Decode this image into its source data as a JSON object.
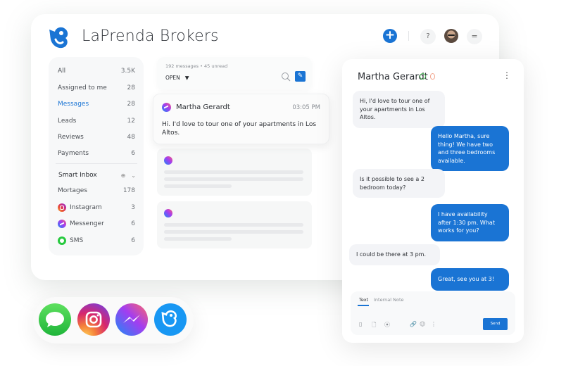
{
  "app": {
    "brand_name": "LaPrenda Brokers",
    "accent_color": "#1a74d4"
  },
  "header": {
    "add_icon": "plus-icon",
    "help_icon": "question-icon",
    "menu_icon": "hamburger-icon",
    "add_label": "+",
    "help_label": "?",
    "menu_label": "="
  },
  "sidebar": {
    "items": [
      {
        "label": "All",
        "count": "3.5K"
      },
      {
        "label": "Assigned to me",
        "count": "28"
      },
      {
        "label": "Messages",
        "count": "28",
        "active": true
      },
      {
        "label": "Leads",
        "count": "12"
      },
      {
        "label": "Reviews",
        "count": "48"
      },
      {
        "label": "Payments",
        "count": "6"
      }
    ],
    "smart_inbox": {
      "title": "Smart Inbox",
      "add_glyph": "⊕",
      "toggle_glyph": "⌄",
      "items": [
        {
          "label": "Mortages",
          "count": "178",
          "icon": "none"
        },
        {
          "label": "Instagram",
          "count": "3",
          "icon": "instagram-icon"
        },
        {
          "label": "Messenger",
          "count": "6",
          "icon": "messenger-icon"
        },
        {
          "label": "SMS",
          "count": "6",
          "icon": "sms-icon"
        }
      ]
    }
  },
  "conversation_list": {
    "summary": "192 messages • 45 unread",
    "filter": {
      "label": "OPEN",
      "caret": "▼"
    },
    "compose_glyph": "✎",
    "active_conversation": {
      "name": "Martha Gerardt",
      "time": "03:05 PM",
      "preview": "Hi. I'd love to tour one of your apartments in Los Altos."
    }
  },
  "chat": {
    "contact_name": "Martha Gerardt",
    "more_glyph": "⋮",
    "messages": [
      {
        "direction": "in",
        "text": "Hi, I'd love to tour one of your apartments in Los Altos."
      },
      {
        "direction": "out",
        "text": "Hello Martha, sure thing! We have two and three bedrooms available."
      },
      {
        "direction": "in",
        "text": "Is it possible to see a 2 bedroom today?"
      },
      {
        "direction": "out",
        "text": "I have availability after 1:30 pm. What works for you?"
      },
      {
        "direction": "in",
        "text": "I could be there at 3 pm."
      },
      {
        "direction": "out",
        "text": "Great, see you at 3!"
      }
    ],
    "composer": {
      "tabs": [
        "Text",
        "Internal Note"
      ],
      "active_tab": "Text",
      "tools": [
        "▯",
        "🗋",
        "⦿",
        "🔗",
        "☺",
        "⋮"
      ],
      "send_label": "Send"
    }
  },
  "channel_dock": {
    "channels": [
      "sms",
      "instagram",
      "messenger",
      "laprenda"
    ]
  }
}
